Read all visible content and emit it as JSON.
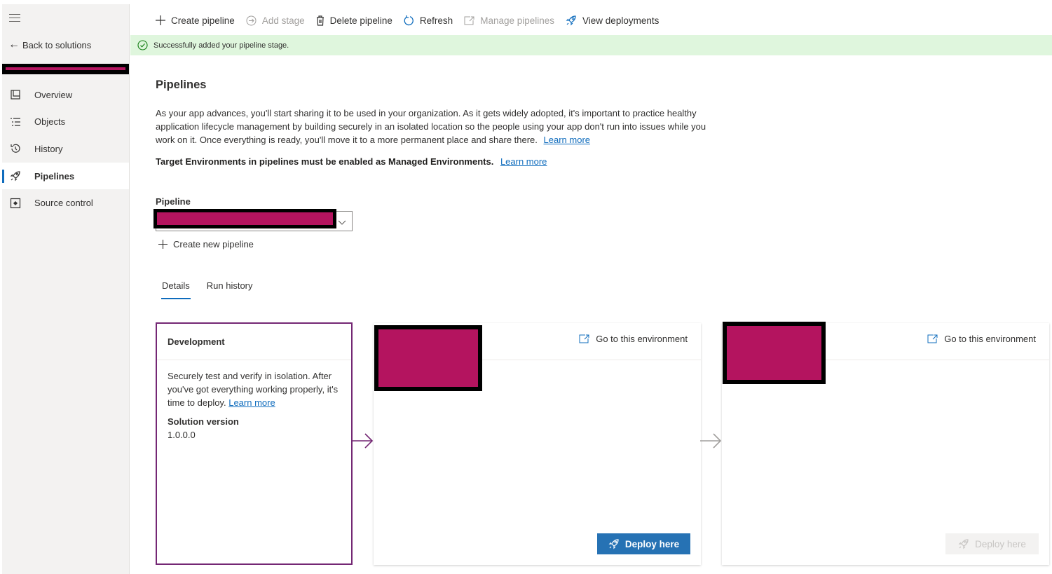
{
  "sidebar": {
    "back_label": "Back to solutions",
    "items": [
      {
        "label": "Overview",
        "icon": "overview-icon"
      },
      {
        "label": "Objects",
        "icon": "objects-icon"
      },
      {
        "label": "History",
        "icon": "history-icon"
      },
      {
        "label": "Pipelines",
        "icon": "rocket-icon",
        "active": true
      },
      {
        "label": "Source control",
        "icon": "source-control-icon"
      }
    ]
  },
  "toolbar": {
    "create_pipeline": "Create pipeline",
    "add_stage": "Add stage",
    "delete_pipeline": "Delete pipeline",
    "refresh": "Refresh",
    "manage_pipelines": "Manage pipelines",
    "view_deployments": "View deployments"
  },
  "notification": {
    "message": "Successfully added your pipeline stage."
  },
  "main": {
    "title": "Pipelines",
    "description": "As your app advances, you'll start sharing it to be used in your organization. As it gets widely adopted, it's important to practice healthy application lifecycle management by building securely in an isolated location so the people using your app don't run into issues while you work on it. Once everything is ready, you'll move it to a more permanent place and share there.",
    "learn_more": "Learn more",
    "warning": "Target Environments in pipelines must be enabled as Managed Environments.",
    "warning_link": "Learn more",
    "pipeline_label": "Pipeline",
    "create_new_pipeline": "Create new pipeline",
    "tabs": [
      {
        "label": "Details",
        "active": true
      },
      {
        "label": "Run history"
      }
    ]
  },
  "stages": {
    "development": {
      "title": "Development",
      "description": "Securely test and verify in isolation. After you've got everything working properly, it's time to deploy.",
      "learn_more": "Learn more",
      "version_label": "Solution version",
      "version": "1.0.0.0"
    },
    "stage1": {
      "goto": "Go to this environment",
      "deploy": "Deploy here",
      "deploy_enabled": true
    },
    "stage2": {
      "goto": "Go to this environment",
      "deploy": "Deploy here",
      "deploy_enabled": false
    }
  },
  "colors": {
    "accent": "#0f6cbd",
    "success_bg": "#dff6dd",
    "stage_border": "#742774",
    "redaction": "#b4145f",
    "deploy_button": "#2672b4"
  }
}
